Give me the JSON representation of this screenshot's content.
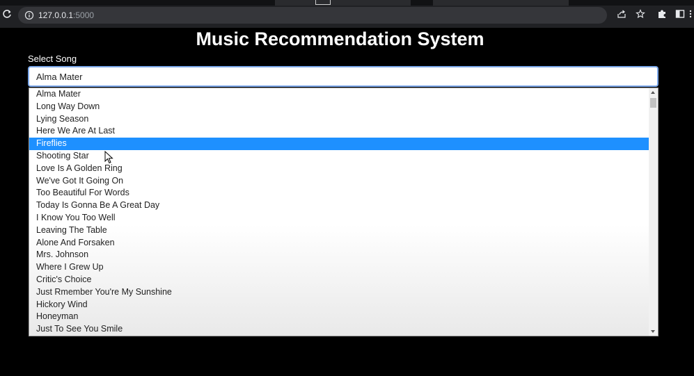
{
  "browser": {
    "url_host": "127.0.0.1",
    "url_port": ":5000"
  },
  "page": {
    "title": "Music Recommendation System",
    "select_label": "Select Song",
    "selected_value": "Alma Mater"
  },
  "dropdown": {
    "highlighted_index": 4,
    "options": [
      "Alma Mater",
      "Long Way Down",
      "Lying Season",
      "Here We Are At Last",
      "Fireflies",
      "Shooting Star",
      "Love Is A Golden Ring",
      "We've Got It Going On",
      "Too Beautiful For Words",
      "Today Is Gonna Be A Great Day",
      "I Know You Too Well",
      "Leaving The Table",
      "Alone And Forsaken",
      "Mrs. Johnson",
      "Where I Grew Up",
      "Critic's Choice",
      "Just Rmember You're My Sunshine",
      "Hickory Wind",
      "Honeyman",
      "Just To See You Smile"
    ]
  },
  "colors": {
    "highlight": "#1e90ff",
    "background": "#000000"
  }
}
